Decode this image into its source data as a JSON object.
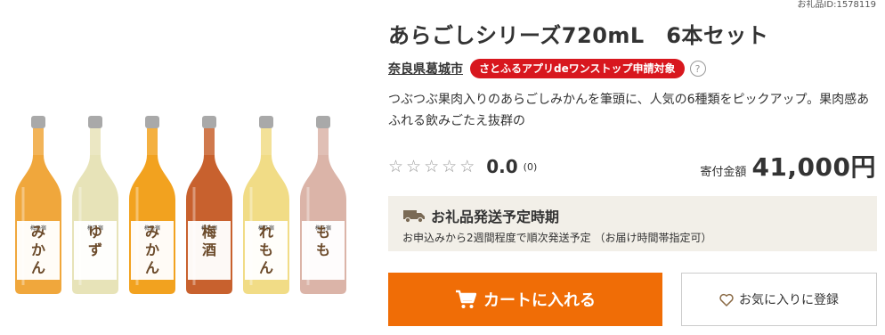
{
  "gift_id": "お礼品ID:1578119",
  "product": {
    "title": "あらごしシリーズ720mL　6本セット",
    "municipality": "奈良県葛城市",
    "app_badge": "さとふるアプリdeワンストップ申請対象",
    "help_icon": "?",
    "description": "つぶつぶ果肉入りのあらごしみかんを筆頭に、人気の6種類をピックアップ。果肉感あふれる飲みごたえ抜群の"
  },
  "bottles": [
    {
      "label": "みかん",
      "liquid": "#f0a73c"
    },
    {
      "label": "ゆず",
      "liquid": "#e7e3b8"
    },
    {
      "label": "みかん",
      "liquid": "#f2a21f"
    },
    {
      "label": "梅酒",
      "liquid": "#c8612e"
    },
    {
      "label": "れもん",
      "liquid": "#f1dc86"
    },
    {
      "label": "もも",
      "liquid": "#dbb4a8"
    }
  ],
  "rating": {
    "stars_filled": 0,
    "stars_total": 5,
    "value": "0.0",
    "count": "(0)"
  },
  "price": {
    "label": "寄付金額",
    "value": "41,000円"
  },
  "shipping": {
    "title": "お礼品発送予定時期",
    "text": "お申込みから2週間程度で順次発送予定 （お届け時間帯指定可）"
  },
  "buttons": {
    "cart": "カートに入れる",
    "favorite": "お気に入りに登録"
  },
  "colors": {
    "cart_button": "#f06d06",
    "badge": "#d8171e",
    "shipping_bg": "#f2efe8"
  },
  "icons": [
    "truck-icon",
    "cart-icon",
    "heart-icon",
    "star-icon",
    "help-icon"
  ]
}
